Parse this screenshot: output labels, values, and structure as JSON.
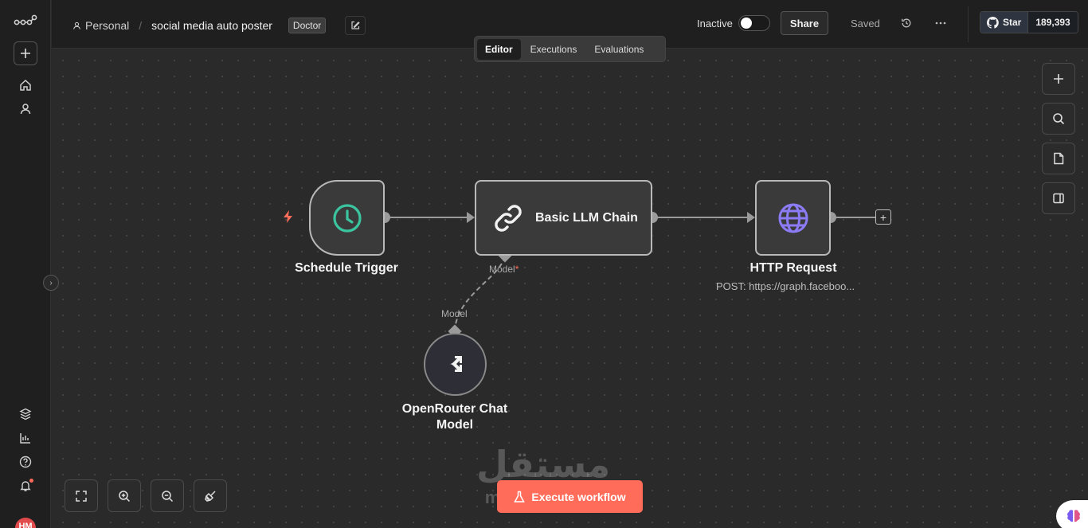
{
  "sidebar": {
    "avatar_initials": "HM"
  },
  "header": {
    "breadcrumb_project": "Personal",
    "workflow_name": "social media auto poster",
    "tag": "Doctor",
    "status_label": "Inactive",
    "share_label": "Share",
    "saved_label": "Saved",
    "github_star_label": "Star",
    "github_star_count": "189,393"
  },
  "tabs": [
    {
      "label": "Editor",
      "active": true
    },
    {
      "label": "Executions",
      "active": false
    },
    {
      "label": "Evaluations",
      "active": false
    }
  ],
  "nodes": {
    "trigger": {
      "title": "Schedule Trigger",
      "icon": "clock-icon"
    },
    "llm": {
      "title": "Basic LLM Chain",
      "icon": "link-icon",
      "model_port_label": "Model",
      "required_marker": "*"
    },
    "http": {
      "title": "HTTP Request",
      "subtitle": "POST: https://graph.faceboo...",
      "icon": "globe-icon"
    },
    "model": {
      "title_line1": "OpenRouter Chat",
      "title_line2": "Model",
      "port_label": "Model",
      "icon": "openrouter-icon"
    }
  },
  "execute_button": {
    "label": "Execute workflow"
  },
  "watermark": {
    "arabic": "مستقل",
    "latin": "mostaql.com"
  },
  "colors": {
    "accent": "#ff6d5a",
    "clock": "#3bc4a0",
    "globe": "#8b7cf6",
    "canvas": "#2a2a2a"
  }
}
